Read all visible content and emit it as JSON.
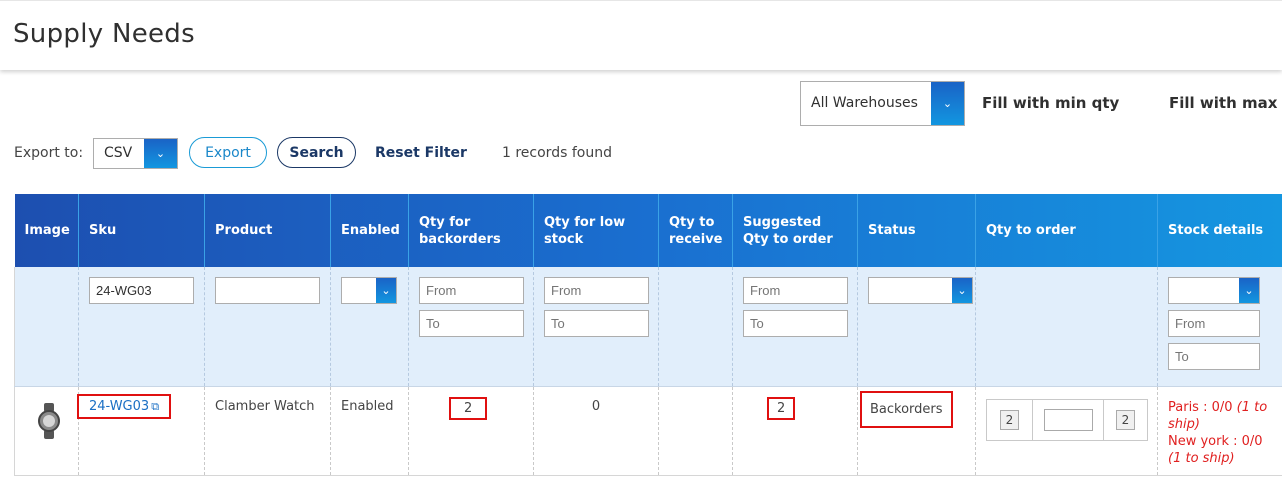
{
  "page": {
    "title": "Supply Needs"
  },
  "toolbar": {
    "warehouse_value": "All Warehouses",
    "fill_min_label": "Fill with min qty",
    "fill_max_label": "Fill with max",
    "export_label": "Export to:",
    "export_format": "CSV",
    "export_button": "Export",
    "search_button": "Search",
    "reset_filter": "Reset Filter",
    "records_found": "1 records found"
  },
  "columns": [
    "Image",
    "Sku",
    "Product",
    "Enabled",
    "Qty for backorders",
    "Qty for low stock",
    "Qty to receive",
    "Suggested Qty to order",
    "Status",
    "Qty to order",
    "Stock details"
  ],
  "filters": {
    "sku_value": "24-WG03",
    "from_placeholder": "From",
    "to_placeholder": "To"
  },
  "row": {
    "sku": "24-WG03",
    "product": "Clamber Watch",
    "enabled": "Enabled",
    "qty_backorders": "2",
    "qty_low_stock": "0",
    "suggested_qty": "2",
    "status": "Backorders",
    "qty_to_order_left": "2",
    "qty_to_order_right": "2",
    "stock_paris": "Paris : 0/0",
    "stock_paris_note": "(1 to ship)",
    "stock_ny": "New york : 0/0",
    "stock_ny_note": "(1 to ship)"
  },
  "colors": {
    "header_start": "#1d4fb0",
    "header_end": "#1596e0",
    "highlight": "#e01010",
    "stock_red": "#e02020"
  }
}
